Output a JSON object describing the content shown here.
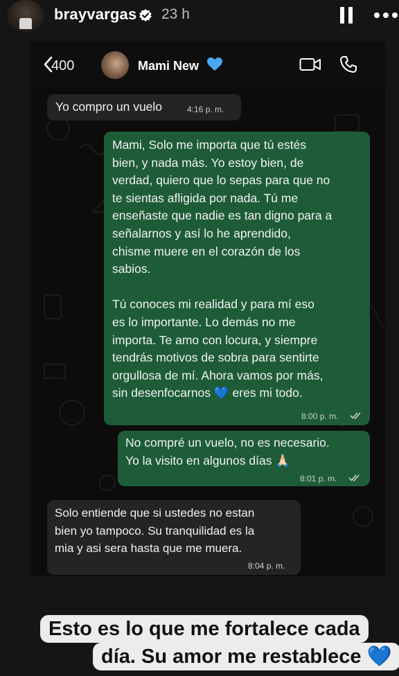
{
  "story": {
    "username": "brayvargas",
    "time_ago": "23 h",
    "icons": {
      "verified": "verified-badge-icon",
      "pause": "pause-icon",
      "more": "more-dots-icon"
    }
  },
  "chat": {
    "back_count": "400",
    "contact_name": "Mami New",
    "contact_emoji": "💙",
    "icons": {
      "back": "chevron-left-icon",
      "video": "video-camera-icon",
      "call": "phone-icon",
      "read": "double-check-icon"
    },
    "colors": {
      "incoming_bubble": "#242424",
      "outgoing_bubble": "#1e5c38",
      "background": "#0c0c0c",
      "heart": "#2f8cff"
    },
    "messages": [
      {
        "direction": "in",
        "text": "Yo compro un vuelo",
        "time": "4:16 p. m."
      },
      {
        "direction": "out",
        "text": "Mami, Solo me importa que tú estés\nbien, y nada más. Yo estoy bien, de\nverdad, quiero que lo sepas para que no\nte sientas afligida por nada. Tú me\nenseñaste que nadie es tan digno para a\nseñalarnos y así lo he aprendido,\nchisme muere en el corazón de los\nsabios.\n\nTú conoces mi realidad  y para mí eso\nes lo importante. Lo demás no me\nimporta. Te amo con locura, y siempre\ntendrás motivos de sobra para sentirte\norgullosa de mí. Ahora vamos por más,\nsin desenfocarnos  💙 eres mi todo.",
        "time": "8:00 p. m."
      },
      {
        "direction": "out",
        "text": "No compré un vuelo, no es necesario.\nYo la visito en algunos días 🙏🏻",
        "time": "8:01 p. m."
      },
      {
        "direction": "in",
        "text": "Solo entiende que si ustedes no estan\nbien yo tampoco. Su tranquilidad es la\nmia y asi sera hasta que me muera.",
        "time": "8:04 p. m."
      }
    ]
  },
  "caption": {
    "line1": "Esto es lo que me fortalece cada",
    "line2": "día. Su amor me restablece 💙"
  }
}
